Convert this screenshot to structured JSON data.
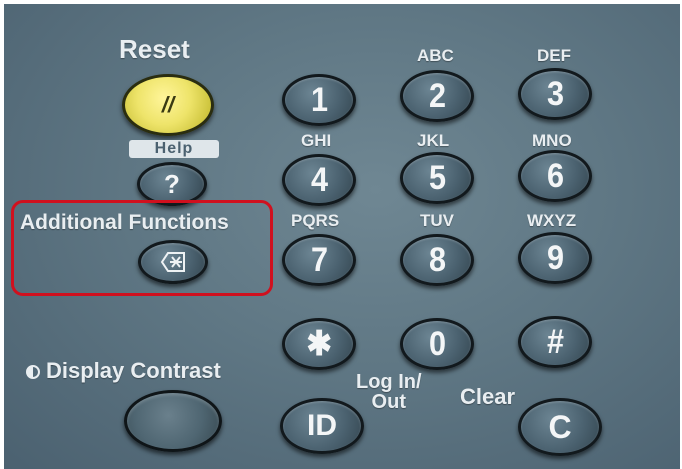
{
  "keypad": {
    "reset_label": "Reset",
    "reset_symbol": "//",
    "help_label": "Help",
    "help_symbol": "?",
    "additional_functions_label": "Additional Functions",
    "display_contrast_label": "Display Contrast",
    "login_label_line1": "Log In/",
    "login_label_line2": "Out",
    "id_label": "ID",
    "clear_label": "Clear",
    "clear_symbol": "C",
    "keys": [
      {
        "digit": "1",
        "letters": ""
      },
      {
        "digit": "2",
        "letters": "ABC"
      },
      {
        "digit": "3",
        "letters": "DEF"
      },
      {
        "digit": "4",
        "letters": "GHI"
      },
      {
        "digit": "5",
        "letters": "JKL"
      },
      {
        "digit": "6",
        "letters": "MNO"
      },
      {
        "digit": "7",
        "letters": "PQRS"
      },
      {
        "digit": "8",
        "letters": "TUV"
      },
      {
        "digit": "9",
        "letters": "WXYZ"
      },
      {
        "digit": "✱",
        "letters": ""
      },
      {
        "digit": "0",
        "letters": ""
      },
      {
        "digit": "#",
        "letters": ""
      }
    ]
  },
  "colors": {
    "panel": "#5f7784",
    "reset_key": "#eee46a",
    "highlight_border": "#d0101e"
  }
}
